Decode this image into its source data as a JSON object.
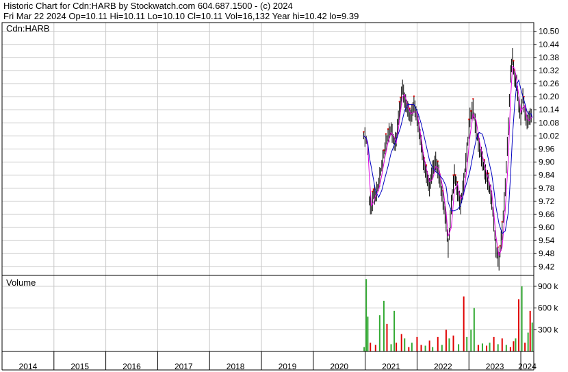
{
  "header": {
    "line1": "Historic Chart for Cdn:HARB by Stockwatch.com 604.687.1500 - (c) 2024",
    "line2": "Fri Mar 22 2024  Op=10.11  Hi=10.11  Lo=10.10  Cl=10.11  Vol=16,132  Year hi=10.42  lo=9.39"
  },
  "chart_data": {
    "type": "line",
    "price_panel_label": "Cdn:HARB",
    "volume_panel_label": "Volume",
    "price_ticks": [
      "10.50",
      "10.44",
      "10.38",
      "10.32",
      "10.26",
      "10.20",
      "10.14",
      "10.08",
      "10.02",
      "9.96",
      "9.90",
      "9.84",
      "9.78",
      "9.72",
      "9.66",
      "9.60",
      "9.54",
      "9.48",
      "9.42"
    ],
    "price_ylim": [
      9.38,
      10.54
    ],
    "volume_ticks": [
      "900 k",
      "600 k",
      "300 k"
    ],
    "volume_tick_values": [
      900000,
      600000,
      300000
    ],
    "volume_ylim": [
      0,
      1050000
    ],
    "x_years": [
      "2014",
      "2015",
      "2016",
      "2017",
      "2018",
      "2019",
      "2020",
      "2021",
      "2022",
      "2023",
      "2024"
    ],
    "x_range": [
      2014.0,
      2024.25
    ],
    "grid": true,
    "series": [
      {
        "name": "",
        "x": [
          2020.97,
          2021.02,
          2021.05,
          2021.08,
          2021.12,
          2021.16,
          2021.2,
          2021.26,
          2021.32,
          2021.38,
          2021.44,
          2021.5,
          2021.56,
          2021.6,
          2021.64,
          2021.68,
          2021.72,
          2021.76,
          2021.82,
          2021.88,
          2021.94,
          2022.0,
          2022.04,
          2022.08,
          2022.12,
          2022.18,
          2022.24,
          2022.3,
          2022.36,
          2022.42,
          2022.5,
          2022.56,
          2022.6,
          2022.66,
          2022.72,
          2022.78,
          2022.84,
          2022.9,
          2022.96,
          2023.02,
          2023.08,
          2023.14,
          2023.2,
          2023.26,
          2023.32,
          2023.38,
          2023.44,
          2023.48,
          2023.52,
          2023.58,
          2023.64,
          2023.7,
          2023.76,
          2023.8,
          2023.84,
          2023.88,
          2023.92,
          2023.96,
          2024.0,
          2024.04,
          2024.08,
          2024.12,
          2024.16,
          2024.2,
          2024.22
        ],
        "close": [
          10.02,
          10.0,
          9.95,
          9.72,
          9.68,
          9.75,
          9.74,
          9.8,
          9.88,
          9.96,
          10.02,
          10.05,
          9.98,
          10.0,
          10.1,
          10.16,
          10.24,
          10.18,
          10.14,
          10.1,
          10.16,
          10.1,
          10.04,
          9.98,
          9.9,
          9.84,
          9.78,
          9.86,
          9.9,
          9.84,
          9.72,
          9.62,
          9.5,
          9.7,
          9.84,
          9.76,
          9.7,
          9.8,
          9.94,
          10.1,
          10.14,
          10.04,
          9.96,
          9.9,
          9.84,
          9.8,
          9.72,
          9.62,
          9.5,
          9.44,
          9.58,
          9.78,
          10.06,
          10.3,
          10.38,
          10.28,
          10.26,
          10.16,
          10.1,
          10.2,
          10.12,
          10.08,
          10.1,
          10.11,
          10.11
        ]
      }
    ],
    "volume": {
      "x": [
        2020.98,
        2021.02,
        2021.05,
        2021.1,
        2021.2,
        2021.28,
        2021.36,
        2021.42,
        2021.5,
        2021.56,
        2021.6,
        2021.7,
        2021.76,
        2021.84,
        2021.9,
        2022.0,
        2022.08,
        2022.16,
        2022.24,
        2022.3,
        2022.4,
        2022.48,
        2022.56,
        2022.62,
        2022.7,
        2022.8,
        2022.9,
        2022.96,
        2023.04,
        2023.1,
        2023.18,
        2023.26,
        2023.34,
        2023.4,
        2023.48,
        2023.56,
        2023.64,
        2023.72,
        2023.8,
        2023.86,
        2023.9,
        2023.96,
        2024.02,
        2024.08,
        2024.14,
        2024.18,
        2024.22
      ],
      "values": [
        60000,
        1000000,
        480000,
        120000,
        90000,
        500000,
        700000,
        380000,
        100000,
        560000,
        120000,
        240000,
        180000,
        60000,
        120000,
        200000,
        90000,
        80000,
        150000,
        60000,
        200000,
        90000,
        300000,
        180000,
        220000,
        100000,
        760000,
        200000,
        300000,
        600000,
        90000,
        110000,
        80000,
        120000,
        200000,
        100000,
        180000,
        90000,
        60000,
        140000,
        180000,
        720000,
        900000,
        120000,
        260000,
        560000,
        400000
      ],
      "up": [
        true,
        true,
        true,
        false,
        false,
        true,
        true,
        false,
        true,
        true,
        false,
        false,
        true,
        false,
        true,
        false,
        false,
        true,
        false,
        true,
        false,
        true,
        false,
        true,
        false,
        true,
        false,
        true,
        true,
        true,
        false,
        true,
        false,
        true,
        false,
        true,
        false,
        true,
        false,
        false,
        true,
        false,
        true,
        false,
        true,
        false,
        true
      ]
    }
  }
}
